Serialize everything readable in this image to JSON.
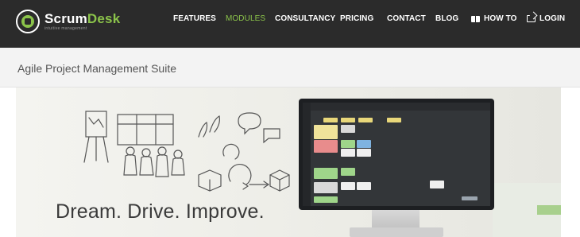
{
  "brand": {
    "name_part1": "Scrum",
    "name_part2": "Desk",
    "tagline": "intuitive management"
  },
  "nav": {
    "items": [
      {
        "label": "FEATURES",
        "active": false
      },
      {
        "label": "MODULES",
        "active": true
      },
      {
        "label": "CONSULTANCY",
        "active": false
      },
      {
        "label": "PRICING",
        "active": false
      },
      {
        "label": "CONTACT",
        "active": false
      },
      {
        "label": "BLOG",
        "active": false
      },
      {
        "label": "HOW TO",
        "active": false,
        "icon": "book-icon"
      },
      {
        "label": "LOGIN",
        "active": false,
        "icon": "login-icon"
      }
    ]
  },
  "subheader": {
    "title": "Agile Project Management Suite"
  },
  "hero": {
    "headline": "Dream. Drive. Improve."
  },
  "colors": {
    "nav_bg": "#2b2b2b",
    "accent": "#8bc34a",
    "subbar_bg": "#f3f3f3"
  }
}
